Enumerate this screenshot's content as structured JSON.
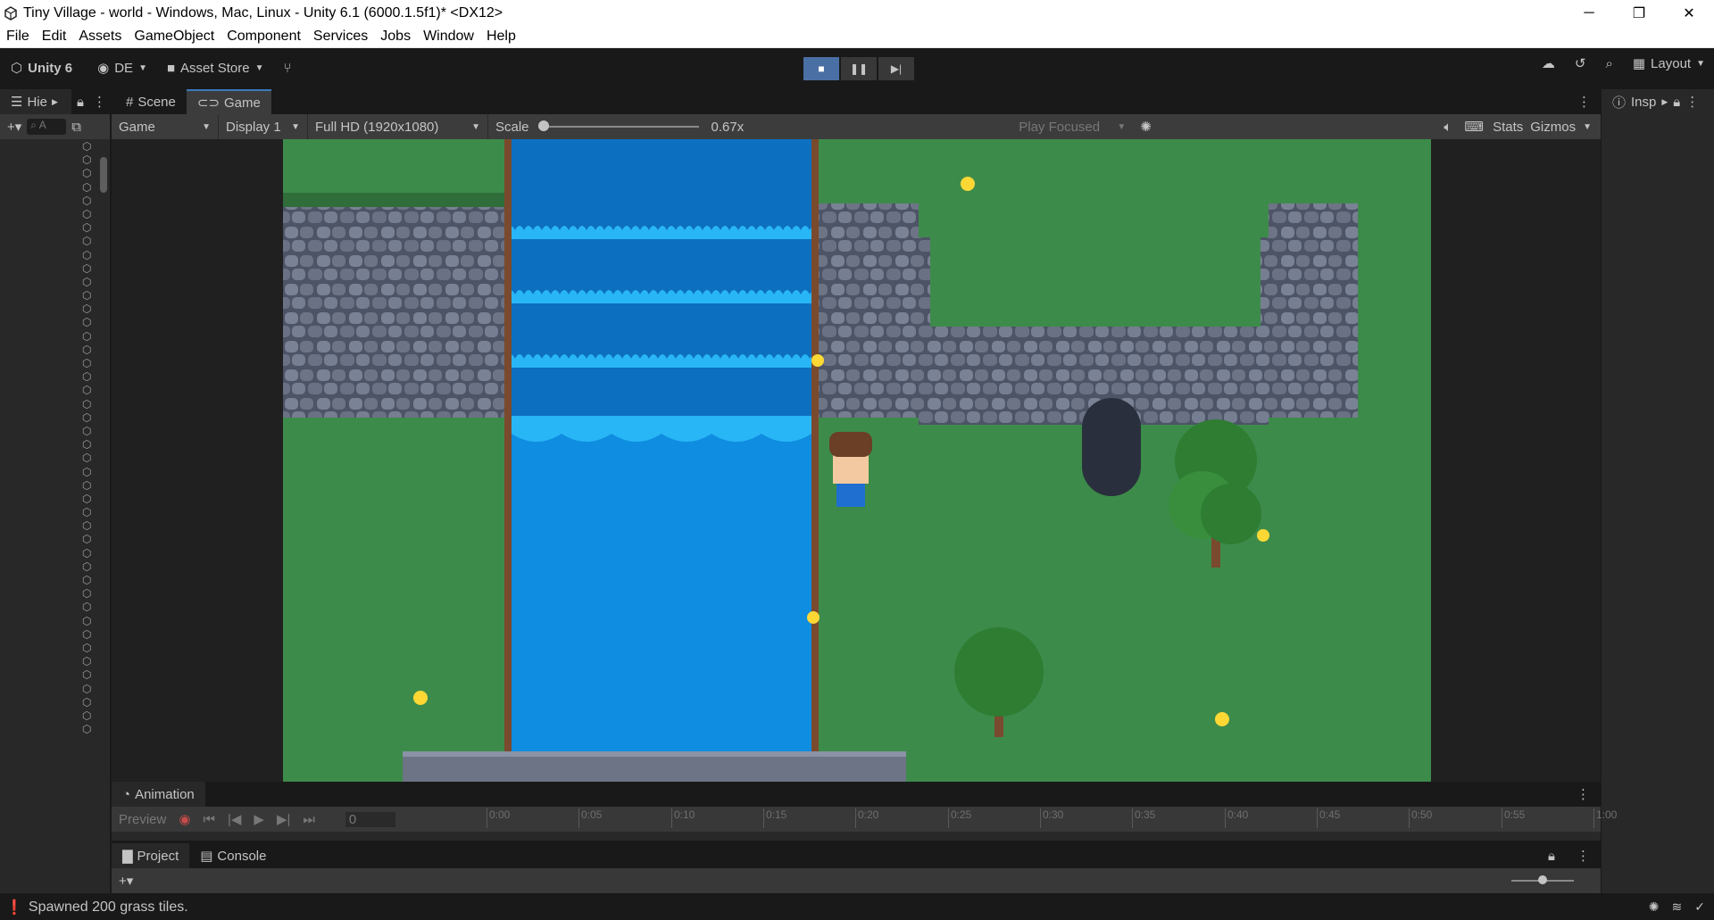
{
  "window": {
    "title": "Tiny Village - world - Windows, Mac, Linux - Unity 6.1 (6000.1.5f1)* <DX12>",
    "minimize": "─",
    "restore": "❐",
    "close": "✕"
  },
  "menubar": [
    "File",
    "Edit",
    "Assets",
    "GameObject",
    "Component",
    "Services",
    "Jobs",
    "Window",
    "Help"
  ],
  "toolbar": {
    "unity_label": "Unity 6",
    "account_label": "DE",
    "asset_store_label": "Asset Store",
    "layout_label": "Layout"
  },
  "tabs": {
    "hierarchy": "Hie",
    "scene": "Scene",
    "game": "Game",
    "inspector": "Insp"
  },
  "hierarchy": {
    "search_placeholder": "A"
  },
  "game_bar": {
    "view_mode": "Game",
    "display": "Display 1",
    "resolution": "Full HD (1920x1080)",
    "scale_label": "Scale",
    "scale_value": "0.67x",
    "play_mode": "Play Focused",
    "stats": "Stats",
    "gizmos": "Gizmos"
  },
  "animation": {
    "tab_label": "Animation",
    "preview_label": "Preview",
    "frame_value": "0",
    "timeline_ticks": [
      "0:00",
      "0:05",
      "0:10",
      "0:15",
      "0:20",
      "0:25",
      "0:30",
      "0:35",
      "0:40",
      "0:45",
      "0:50",
      "0:55",
      "1:00"
    ]
  },
  "project": {
    "project_tab": "Project",
    "console_tab": "Console"
  },
  "status": {
    "message": "Spawned 200 grass tiles."
  },
  "colors": {
    "editor_bg": "#191919",
    "panel_bg": "#282828",
    "accent": "#3a79bb",
    "grass": "#3d8b4a",
    "water": "#1a8fe0",
    "stone": "#6d7486"
  }
}
